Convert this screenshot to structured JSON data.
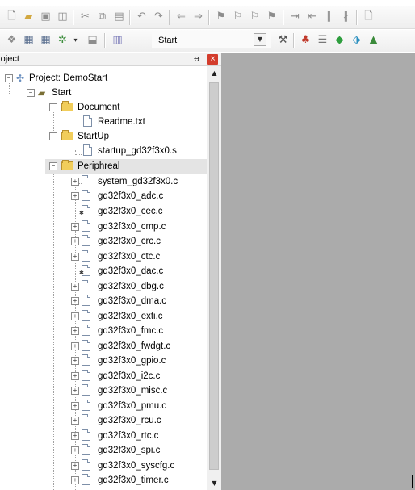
{
  "toolbar1": {
    "icons": [
      "new-file-icon",
      "open-folder-icon",
      "save-icon",
      "save-all-icon",
      "cut-icon",
      "copy-icon",
      "paste-icon",
      "undo-icon",
      "redo-icon",
      "nav-back-icon",
      "nav-forward-icon",
      "bookmark-icon",
      "bookmark-prev-icon",
      "bookmark-next-icon",
      "bookmark-clear-icon",
      "indent-icon",
      "unindent-icon",
      "comment-icon",
      "uncomment-icon",
      "open-doc-icon"
    ]
  },
  "toolbar2": {
    "target_name": "Start",
    "icons": [
      "translate-icon",
      "build-icon",
      "rebuild-icon",
      "batch-build-icon",
      "download-icon",
      "load-icon",
      "target-options-icon",
      "file-extensions-icon",
      "books-icon",
      "functions-icon",
      "templates-icon"
    ]
  },
  "panel": {
    "title": "roject",
    "pin_glyph": "ᵽ",
    "close_glyph": "×"
  },
  "tree": {
    "root": "Project: DemoStart",
    "target": "Start",
    "groups": {
      "document": {
        "label": "Document",
        "files": [
          "Readme.txt"
        ]
      },
      "startup": {
        "label": "StartUp",
        "files": [
          "startup_gd32f3x0.s"
        ]
      },
      "peripheral": {
        "label": "Periphreal",
        "files": [
          "system_gd32f3x0.c",
          "gd32f3x0_adc.c",
          "gd32f3x0_cec.c",
          "gd32f3x0_cmp.c",
          "gd32f3x0_crc.c",
          "gd32f3x0_ctc.c",
          "gd32f3x0_dac.c",
          "gd32f3x0_dbg.c",
          "gd32f3x0_dma.c",
          "gd32f3x0_exti.c",
          "gd32f3x0_fmc.c",
          "gd32f3x0_fwdgt.c",
          "gd32f3x0_gpio.c",
          "gd32f3x0_i2c.c",
          "gd32f3x0_misc.c",
          "gd32f3x0_pmu.c",
          "gd32f3x0_rcu.c",
          "gd32f3x0_rtc.c",
          "gd32f3x0_spi.c",
          "gd32f3x0_syscfg.c",
          "gd32f3x0_timer.c"
        ]
      }
    }
  },
  "colors": {
    "editor_bg": "#ababab",
    "selection_bg": "#e4e4e4",
    "folder": "#f1cd5a",
    "close_button": "#d33c2c"
  }
}
